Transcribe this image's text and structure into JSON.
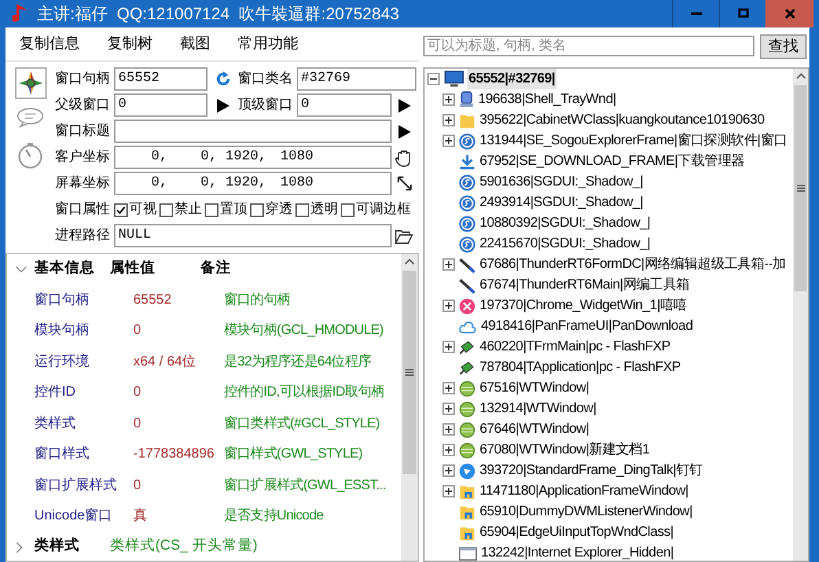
{
  "window": {
    "title": "主讲:福仔  QQ:121007124  吹牛裝逼群:20752843"
  },
  "menu": [
    "复制信息",
    "复制树",
    "截图",
    "常用功能"
  ],
  "form": {
    "handle": {
      "label": "窗口句柄",
      "value": "65552"
    },
    "class_name": {
      "label": "窗口类名",
      "value": "#32769"
    },
    "parent": {
      "label": "父级窗口",
      "value": "0"
    },
    "top_window": {
      "label": "顶级窗口",
      "value": "0"
    },
    "title": {
      "label": "窗口标题"
    },
    "client_rect": {
      "label": "客户坐标",
      "values": [
        "0,",
        "0,",
        "1920,",
        "1080"
      ]
    },
    "screen_rect": {
      "label": "屏幕坐标",
      "values": [
        "0,",
        "0,",
        "1920,",
        "1080"
      ]
    },
    "attributes": {
      "label": "窗口属性",
      "options": [
        {
          "label": "可视",
          "checked": true
        },
        {
          "label": "禁止",
          "checked": false
        },
        {
          "label": "置顶",
          "checked": false
        },
        {
          "label": "穿透",
          "checked": false
        },
        {
          "label": "透明",
          "checked": false
        },
        {
          "label": "可调边框",
          "checked": false
        }
      ]
    },
    "process_path": {
      "label": "进程路径",
      "value": "NULL"
    }
  },
  "property_grid": {
    "sections": [
      {
        "title": "基本信息",
        "expanded": true,
        "columns": [
          "属性值",
          "备注"
        ],
        "rows": [
          {
            "name": "窗口句柄",
            "value": "65552",
            "note": "窗口的句柄"
          },
          {
            "name": "模块句柄",
            "value": "0",
            "note": "模块句柄(GCL_HMODULE)"
          },
          {
            "name": "运行环境",
            "value": "x64 / 64位",
            "note": "是32为程序还是64位程序"
          },
          {
            "name": "控件ID",
            "value": "0",
            "note": "控件的ID,可以根据ID取句柄"
          },
          {
            "name": "类样式",
            "value": "0",
            "note": "窗口类样式(#GCL_STYLE)"
          },
          {
            "name": "窗口样式",
            "value": "-1778384896",
            "note": "窗口样式(GWL_STYLE)"
          },
          {
            "name": "窗口扩展样式",
            "value": "0",
            "note": "窗口扩展样式(GWL_ESST..."
          },
          {
            "name": "Unicode窗口",
            "value": "真",
            "note": "是否支持Unicode"
          }
        ]
      },
      {
        "title": "类样式",
        "expanded": false,
        "value": "类样式(CS_ 开头常量)"
      }
    ]
  },
  "search": {
    "placeholder": "可以为标题, 句柄, 类名"
  },
  "find_button": "查找",
  "tree": {
    "label": "65552|#32769|",
    "kind": "monitor",
    "expanded": true,
    "selected": true,
    "children": [
      {
        "label": "196638|Shell_TrayWnd|",
        "kind": "tray",
        "expandable": true
      },
      {
        "label": "395622|CabinetWClass|kuangkoutance10190630",
        "kind": "folder",
        "expandable": true
      },
      {
        "label": "131944|SE_SogouExplorerFrame|窗口探测软件|窗口",
        "kind": "sogou",
        "expandable": true
      },
      {
        "label": "67952|SE_DOWNLOAD_FRAME|下载管理器",
        "kind": "download",
        "expandable": false
      },
      {
        "label": "5901636|SGDUI:_Shadow_|",
        "kind": "sogou",
        "expandable": false
      },
      {
        "label": "2493914|SGDUI:_Shadow_|",
        "kind": "sogou",
        "expandable": false
      },
      {
        "label": "10880392|SGDUI:_Shadow_|",
        "kind": "sogou",
        "expandable": false
      },
      {
        "label": "22415670|SGDUI:_Shadow_|",
        "kind": "sogou",
        "expandable": false
      },
      {
        "label": "67686|ThunderRT6FormDC|网络编辑超级工具箱--加",
        "kind": "pen",
        "expandable": true
      },
      {
        "label": "67674|ThunderRT6Main|网编工具箱",
        "kind": "pen",
        "expandable": false
      },
      {
        "label": "197370|Chrome_WidgetWin_1|嘻嘻",
        "kind": "pink",
        "expandable": true
      },
      {
        "label": "4918416|PanFrameUI|PanDownload",
        "kind": "cloud",
        "expandable": false
      },
      {
        "label": "460220|TFrmMain|pc - FlashFXP",
        "kind": "bolt",
        "expandable": true
      },
      {
        "label": "787804|TApplication|pc - FlashFXP",
        "kind": "bolt",
        "expandable": false
      },
      {
        "label": "67516|WTWindow|",
        "kind": "ball",
        "expandable": true
      },
      {
        "label": "132914|WTWindow|",
        "kind": "ball",
        "expandable": true
      },
      {
        "label": "67646|WTWindow|",
        "kind": "ball",
        "expandable": true
      },
      {
        "label": "67080|WTWindow|新建文档1",
        "kind": "ball",
        "expandable": true
      },
      {
        "label": "393720|StandardFrame_DingTalk|钉钉",
        "kind": "ding",
        "expandable": true
      },
      {
        "label": "11471180|ApplicationFrameWindow|",
        "kind": "appfolder",
        "expandable": true
      },
      {
        "label": "65910|DummyDWMListenerWindow|",
        "kind": "appfolder",
        "expandable": false
      },
      {
        "label": "65904|EdgeUiInputTopWndClass|",
        "kind": "appfolder",
        "expandable": false
      },
      {
        "label": "132242|Internet Explorer_Hidden|",
        "kind": "window",
        "expandable": false
      }
    ]
  }
}
